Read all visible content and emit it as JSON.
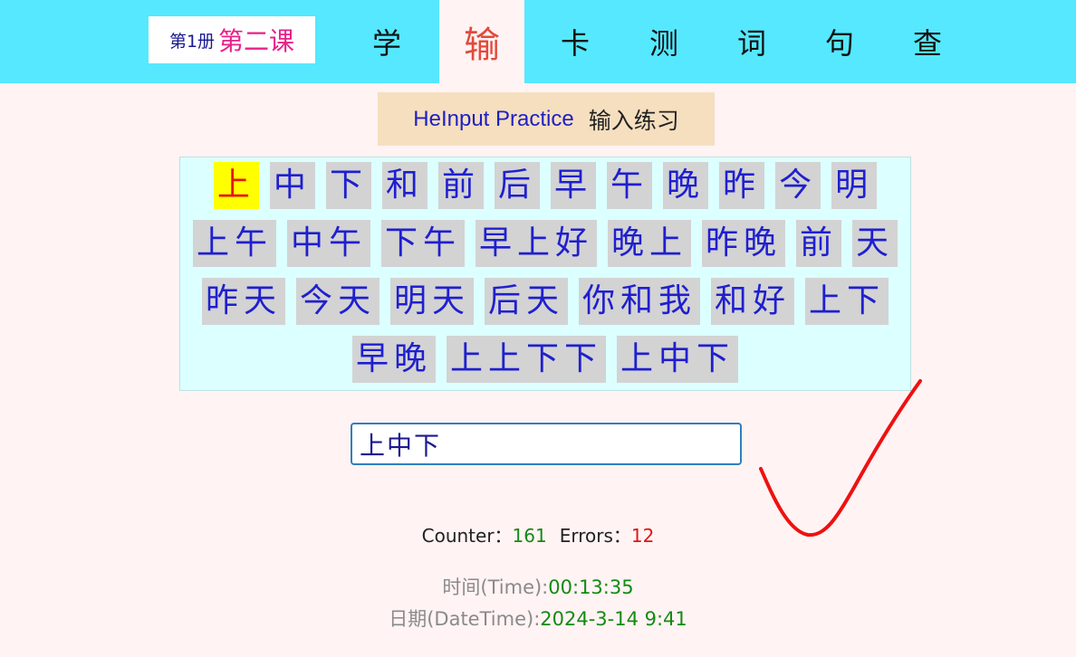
{
  "header": {
    "book_label": "第1册",
    "lesson_label": "第二课",
    "nav": [
      {
        "label": "学",
        "active": false
      },
      {
        "label": "输",
        "active": true
      },
      {
        "label": "卡",
        "active": false
      },
      {
        "label": "测",
        "active": false
      },
      {
        "label": "词",
        "active": false
      },
      {
        "label": "句",
        "active": false
      },
      {
        "label": "查",
        "active": false
      }
    ]
  },
  "title": {
    "english": "HeInput Practice",
    "chinese": "输入练习"
  },
  "tiles": [
    "上",
    "中",
    "下",
    "和",
    "前",
    "后",
    "早",
    "午",
    "晚",
    "昨",
    "今",
    "明",
    "上午",
    "中午",
    "下午",
    "早上好",
    "晚上",
    "昨晚",
    "前",
    "天",
    "昨天",
    "今天",
    "明天",
    "后天",
    "你和我",
    "和好",
    "上下",
    "早晚",
    "上上下下",
    "上中下"
  ],
  "current_tile_index": 0,
  "answer": {
    "value": "上中下",
    "result_icon": "red-check-icon",
    "mark_color": "#ee1111"
  },
  "stats": {
    "counter_label": "Counter：",
    "counter_value": "161",
    "errors_label": "Errors：",
    "errors_value": "12"
  },
  "time": {
    "label": "时间(Time):",
    "value": "00:13:35"
  },
  "date": {
    "label": "日期(DateTime):",
    "value": "2024-3-14 9:41"
  },
  "colors": {
    "topbar": "#55e8ff",
    "page_background": "#fff3f3",
    "active_nav": "#e24a3a",
    "tile_text": "#1f1fd0",
    "tile_highlight": "#ffff00"
  }
}
